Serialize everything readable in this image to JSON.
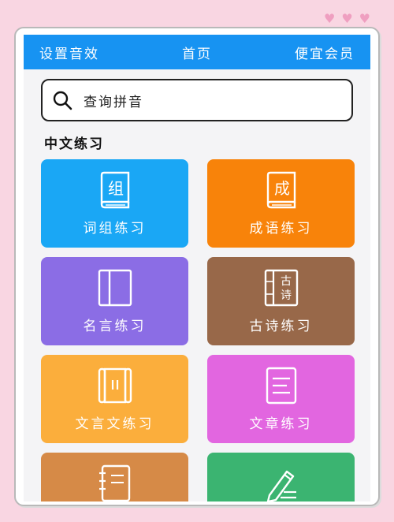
{
  "topbar": {
    "left": "设置音效",
    "center": "首页",
    "right": "便宜会员"
  },
  "search": {
    "placeholder": "查询拼音"
  },
  "section": {
    "title": "中文练习"
  },
  "cards": [
    {
      "label": "词组练习",
      "icon": "book-zu-icon",
      "icon_text": "组",
      "color": "#1aa7f5"
    },
    {
      "label": "成语练习",
      "icon": "book-cheng-icon",
      "icon_text": "成",
      "color": "#f8830a"
    },
    {
      "label": "名言练习",
      "icon": "open-book-icon",
      "color": "#8b6de5"
    },
    {
      "label": "古诗练习",
      "icon": "poem-book-icon",
      "icon_text_1": "古",
      "icon_text_2": "诗",
      "color": "#986849"
    },
    {
      "label": "文言文练习",
      "icon": "scroll-icon",
      "color": "#fbae3c"
    },
    {
      "label": "文章练习",
      "icon": "document-icon",
      "color": "#e266e0"
    },
    {
      "label": "",
      "icon": "notebook-icon",
      "color": "#d68a47"
    },
    {
      "label": "",
      "icon": "pencil-icon",
      "color": "#3bb471"
    }
  ],
  "decor": {
    "hearts": [
      "♥",
      "♥",
      "♥"
    ],
    "heart_color": "#ef9fc0"
  }
}
